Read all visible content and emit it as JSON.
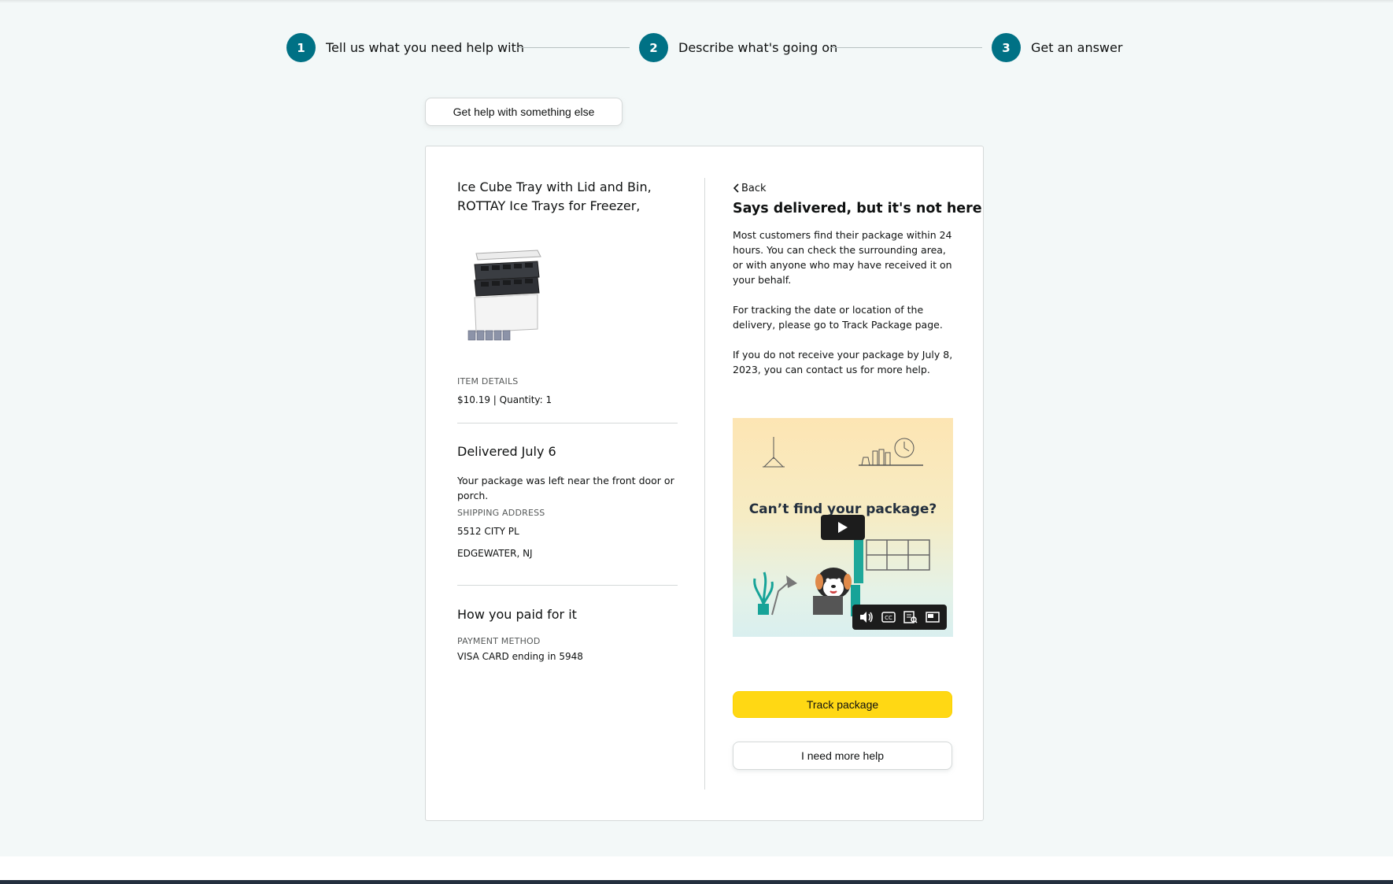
{
  "stepper": {
    "steps": [
      {
        "num": "1",
        "label": "Tell us what you need help with"
      },
      {
        "num": "2",
        "label": "Describe what's going on"
      },
      {
        "num": "3",
        "label": "Get an answer"
      }
    ]
  },
  "help_else_label": "Get help with something else",
  "product": {
    "title": "Ice Cube Tray with Lid and Bin, ROTTAY Ice Trays for Freezer, Easy-…",
    "item_details_label": "ITEM DETAILS",
    "item_details_value": "$10.19 | Quantity: 1"
  },
  "delivery": {
    "heading": "Delivered July 6",
    "message": "Your package was left near the front door or porch.",
    "shipping_label": "SHIPPING ADDRESS",
    "address_line1": "5512 CITY PL",
    "address_line2": "EDGEWATER, NJ"
  },
  "payment": {
    "heading": "How you paid for it",
    "method_label": "PAYMENT METHOD",
    "method_value": "VISA CARD ending in 5948"
  },
  "answer": {
    "back_label": "Back",
    "title": "Says delivered, but it's not here",
    "para1": "Most customers find their package within 24 hours. You can check the surrounding area, or with anyone who may have received it on your behalf.",
    "para2": "For tracking the date or location of the delivery, please go to Track Package page.",
    "para3": "If you do not receive your package by July 8, 2023, you can contact us for more help."
  },
  "video": {
    "title": "Can’t find your package?",
    "controls": [
      "volume-icon",
      "captions-icon",
      "transcript-icon",
      "picture-in-picture-icon"
    ]
  },
  "buttons": {
    "track": "Track package",
    "more_help": "I need more help"
  },
  "colors": {
    "accent": "#007185",
    "primary_button": "#ffd814",
    "footer": "#232f3e"
  }
}
